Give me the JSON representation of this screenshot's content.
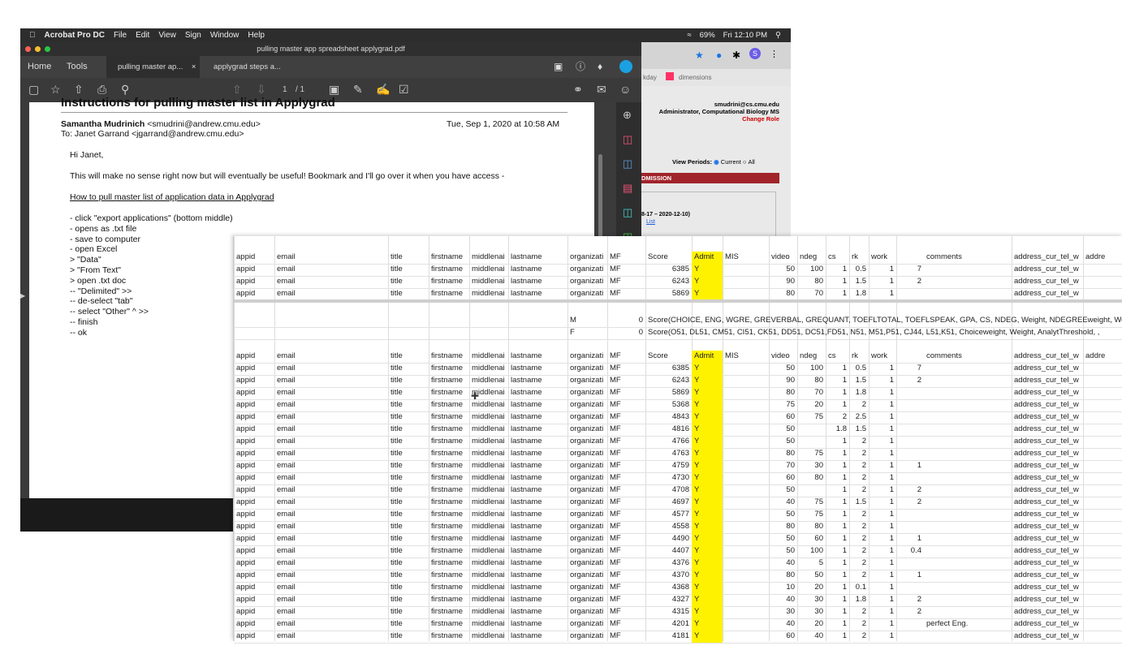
{
  "menubar": {
    "app": "Acrobat Pro DC",
    "items": [
      "File",
      "Edit",
      "View",
      "Sign",
      "Window",
      "Help"
    ],
    "status": {
      "battery": "69%",
      "datetime": "Fri 12:10 PM"
    }
  },
  "acrobat": {
    "window_title": "pulling master app spreadsheet applygrad.pdf",
    "tabs": {
      "home": "Home",
      "tools": "Tools",
      "doc1": "pulling master ap...",
      "doc2": "applygrad steps a..."
    },
    "page_indicator": {
      "current": "1",
      "total": "/ 1"
    }
  },
  "email": {
    "title_partial": "Instructions for pulling master list in Applygrad",
    "from_name": "Samantha Mudrinich",
    "from_email": "<smudrini@andrew.cmu.edu>",
    "date": "Tue, Sep 1, 2020 at 10:58 AM",
    "to": "To: Janet Garrand <jgarrand@andrew.cmu.edu>",
    "greeting": "Hi Janet,",
    "intro": "This will make no sense right now but will eventually be useful! Bookmark and I'll go over it when you have access -",
    "link": "How to pull master list of application data in Applygrad",
    "steps": [
      "- click \"export applications\" (bottom middle)",
      "- opens as .txt file",
      "- save to computer",
      "- open Excel",
      "> \"Data\"",
      "> \"From Text\"",
      "> open .txt doc",
      "-- \"Delimited\" >>",
      "-- de-select \"tab\"",
      "-- select \"Other\" ^ >>",
      "-- finish",
      "-- ok"
    ]
  },
  "browser": {
    "bookmark1": "kday",
    "bookmark2": "dimensions",
    "user_email": "smudrini@cs.cmu.edu",
    "role": "Administrator, Computational Biology MS",
    "change_role": "Change Role",
    "view_periods_label": "View Periods:",
    "opt_current": "Current",
    "opt_all": "All",
    "admission_band": "DMISSION",
    "period": "8-17 – 2020-12-10)",
    "list_link": "List"
  },
  "sheet": {
    "headers": [
      "appid",
      "email",
      "title",
      "firstname",
      "middlename",
      "lastname",
      "organization",
      "MF",
      "Score",
      "Admit",
      "MIS",
      "video",
      "ndeg",
      "cs",
      "rk",
      "work",
      "comments",
      "address_cur_tel_w",
      "addre"
    ],
    "top_rows": [
      [
        "6385",
        "Y",
        "50",
        "100",
        "1",
        "0.5",
        "1",
        "7",
        ""
      ],
      [
        "6243",
        "Y",
        "90",
        "80",
        "1",
        "1.5",
        "1",
        "2",
        ""
      ],
      [
        "5869",
        "Y",
        "80",
        "70",
        "1",
        "1.8",
        "1",
        "",
        ""
      ]
    ],
    "formula_rows": [
      {
        "mf": "M",
        "zero": "0",
        "text": "Score(CHOICE, ENG, WGRE, GREVERBAL, GREQUANT, TOEFLTOTAL, TOEFLSPEAK, GPA, CS, NDEG, Weight, NDEGREEweight, Work"
      },
      {
        "mf": "F",
        "zero": "0",
        "text": "Score(O51, DL51, CM51, CI51, CK51, DD51, DC51,FD51, N51, M51,P51, CJ44, L51,K51, Choiceweight, Weight, AnalytThreshold, ,"
      }
    ],
    "rows": [
      [
        "6385",
        "Y",
        "50",
        "100",
        "1",
        "0.5",
        "1",
        "7",
        ""
      ],
      [
        "6243",
        "Y",
        "90",
        "80",
        "1",
        "1.5",
        "1",
        "2",
        ""
      ],
      [
        "5869",
        "Y",
        "80",
        "70",
        "1",
        "1.8",
        "1",
        "",
        ""
      ],
      [
        "5368",
        "Y",
        "75",
        "20",
        "1",
        "2",
        "1",
        "",
        ""
      ],
      [
        "4843",
        "Y",
        "60",
        "75",
        "2",
        "2.5",
        "1",
        "",
        ""
      ],
      [
        "4816",
        "Y",
        "50",
        "",
        "1.8",
        "1.5",
        "1",
        "",
        ""
      ],
      [
        "4766",
        "Y",
        "50",
        "",
        "1",
        "2",
        "1",
        "",
        ""
      ],
      [
        "4763",
        "Y",
        "80",
        "75",
        "1",
        "2",
        "1",
        "",
        ""
      ],
      [
        "4759",
        "Y",
        "70",
        "30",
        "1",
        "2",
        "1",
        "1",
        ""
      ],
      [
        "4730",
        "Y",
        "60",
        "80",
        "1",
        "2",
        "1",
        "",
        ""
      ],
      [
        "4708",
        "Y",
        "50",
        "",
        "1",
        "2",
        "1",
        "2",
        ""
      ],
      [
        "4697",
        "Y",
        "40",
        "75",
        "1",
        "1.5",
        "1",
        "2",
        ""
      ],
      [
        "4577",
        "Y",
        "50",
        "75",
        "1",
        "2",
        "1",
        "",
        ""
      ],
      [
        "4558",
        "Y",
        "80",
        "80",
        "1",
        "2",
        "1",
        "",
        ""
      ],
      [
        "4490",
        "Y",
        "50",
        "60",
        "1",
        "2",
        "1",
        "1",
        ""
      ],
      [
        "4407",
        "Y",
        "50",
        "100",
        "1",
        "2",
        "1",
        "0.4",
        ""
      ],
      [
        "4376",
        "Y",
        "40",
        "5",
        "1",
        "2",
        "1",
        "",
        ""
      ],
      [
        "4370",
        "Y",
        "80",
        "50",
        "1",
        "2",
        "1",
        "1",
        ""
      ],
      [
        "4368",
        "Y",
        "10",
        "20",
        "1",
        "0.1",
        "1",
        "",
        ""
      ],
      [
        "4327",
        "Y",
        "40",
        "30",
        "1",
        "1.8",
        "1",
        "2",
        ""
      ],
      [
        "4315",
        "Y",
        "30",
        "30",
        "1",
        "2",
        "1",
        "2",
        ""
      ],
      [
        "4201",
        "Y",
        "40",
        "20",
        "1",
        "2",
        "1",
        "",
        "perfect Eng."
      ],
      [
        "4181",
        "Y",
        "60",
        "40",
        "1",
        "2",
        "1",
        "",
        ""
      ]
    ],
    "text_cells": [
      "appid",
      "email",
      "title",
      "firstname",
      "middlenai",
      "lastname",
      "organizati",
      "MF",
      "address_cur_tel_w",
      "addre"
    ]
  },
  "colors": {
    "highlight": "#fff200",
    "acrobat_dark": "#3b3b3b"
  }
}
